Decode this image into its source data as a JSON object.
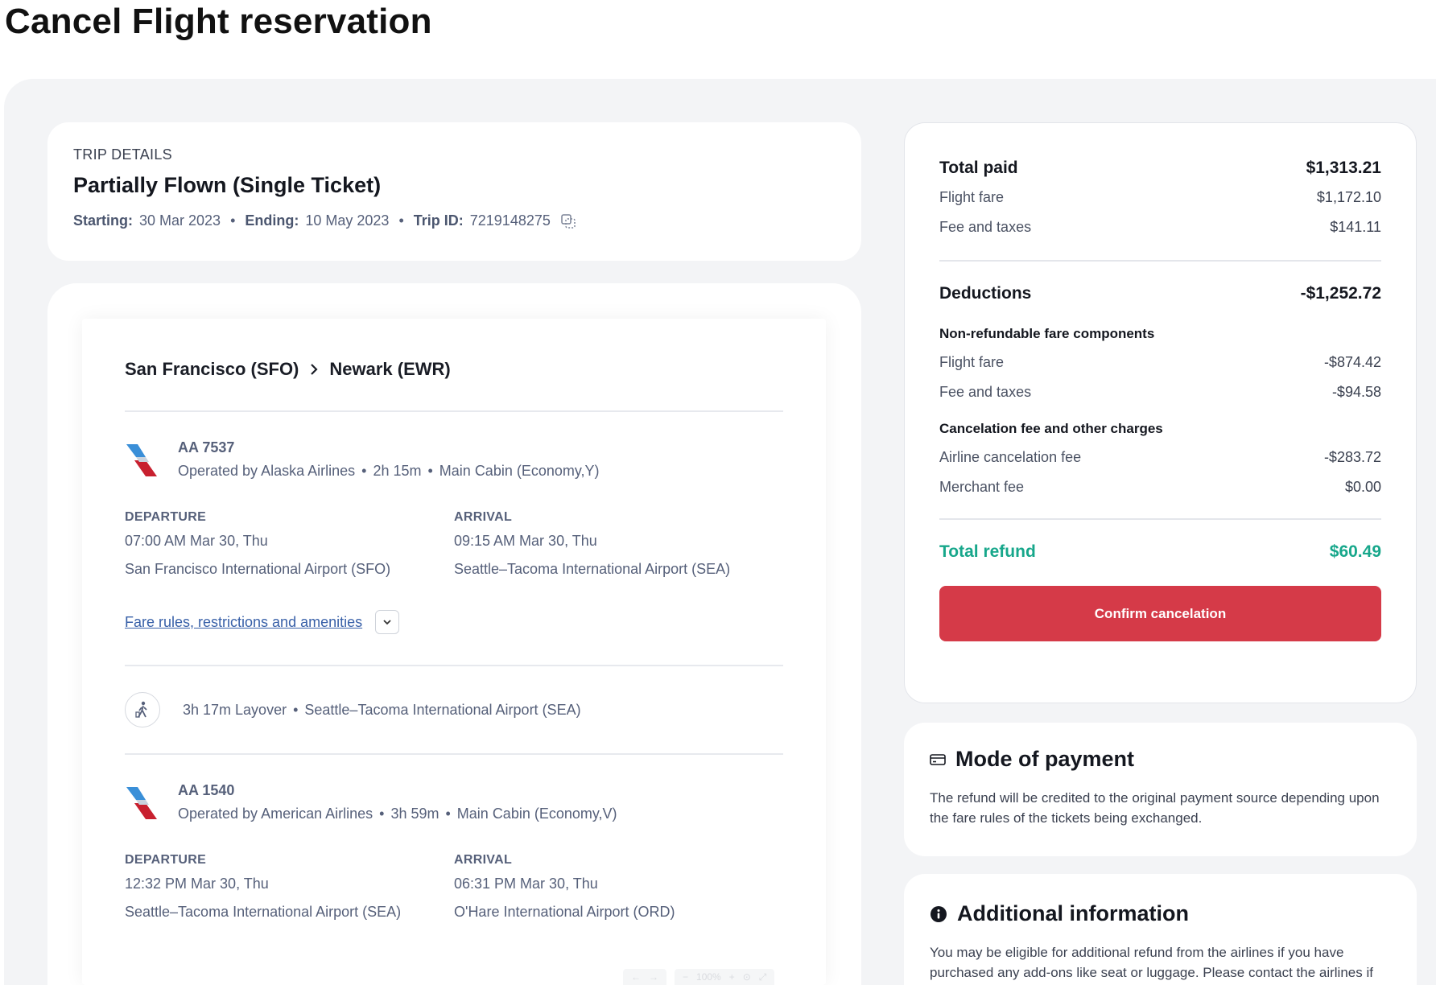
{
  "page": {
    "title": "Cancel Flight reservation"
  },
  "trip": {
    "eyebrow": "TRIP DETAILS",
    "title": "Partially Flown (Single Ticket)",
    "starting_label": "Starting:",
    "starting": "30 Mar 2023",
    "ending_label": "Ending:",
    "ending": "10 May 2023",
    "trip_id_label": "Trip ID:",
    "trip_id": "7219148275"
  },
  "itinerary": {
    "origin": "San Francisco (SFO)",
    "destination": "Newark (EWR)",
    "segments": [
      {
        "flight": "AA 7537",
        "operator": "Operated by Alaska Airlines",
        "duration": "2h 15m",
        "cabin": "Main Cabin (Economy,Y)",
        "dep_label": "DEPARTURE",
        "dep_time": "07:00 AM Mar 30, Thu",
        "dep_airport": "San Francisco International Airport (SFO)",
        "arr_label": "ARRIVAL",
        "arr_time": "09:15 AM Mar 30, Thu",
        "arr_airport": "Seattle–Tacoma International Airport (SEA)",
        "fare_link": "Fare rules, restrictions and amenities"
      },
      {
        "flight": "AA 1540",
        "operator": "Operated by American Airlines",
        "duration": "3h 59m",
        "cabin": "Main Cabin (Economy,V)",
        "dep_label": "DEPARTURE",
        "dep_time": "12:32 PM Mar 30, Thu",
        "dep_airport": "Seattle–Tacoma International Airport (SEA)",
        "arr_label": "ARRIVAL",
        "arr_time": "06:31 PM Mar 30, Thu",
        "arr_airport": "O'Hare International Airport (ORD)"
      }
    ],
    "layover": {
      "duration": "3h 17m Layover",
      "airport": "Seattle–Tacoma International Airport (SEA)"
    },
    "zoom_label": "100%"
  },
  "summary": {
    "total_paid_label": "Total paid",
    "total_paid": "$1,313.21",
    "flight_fare_label": "Flight fare",
    "flight_fare": "$1,172.10",
    "fee_taxes_label": "Fee and taxes",
    "fee_taxes": "$141.11",
    "deductions_label": "Deductions",
    "deductions": "-$1,252.72",
    "nonref_heading": "Non-refundable fare components",
    "nonref_fare_label": "Flight fare",
    "nonref_fare": "-$874.42",
    "nonref_fee_label": "Fee and taxes",
    "nonref_fee": "-$94.58",
    "cancel_heading": "Cancelation fee and other charges",
    "airline_fee_label": "Airline cancelation fee",
    "airline_fee": "-$283.72",
    "merchant_fee_label": "Merchant fee",
    "merchant_fee": "$0.00",
    "total_refund_label": "Total refund",
    "total_refund": "$60.49",
    "confirm_label": "Confirm cancelation",
    "refund_color": "#17a78b",
    "confirm_color": "#d53a48"
  },
  "payment": {
    "heading": "Mode of payment",
    "text": "The refund will be credited to the original payment source depending upon the fare rules of the tickets being exchanged."
  },
  "additional": {
    "heading": "Additional information",
    "text": "You may be eligible for additional refund from the airlines if you have purchased any add-ons like seat or luggage. Please contact the airlines if"
  }
}
